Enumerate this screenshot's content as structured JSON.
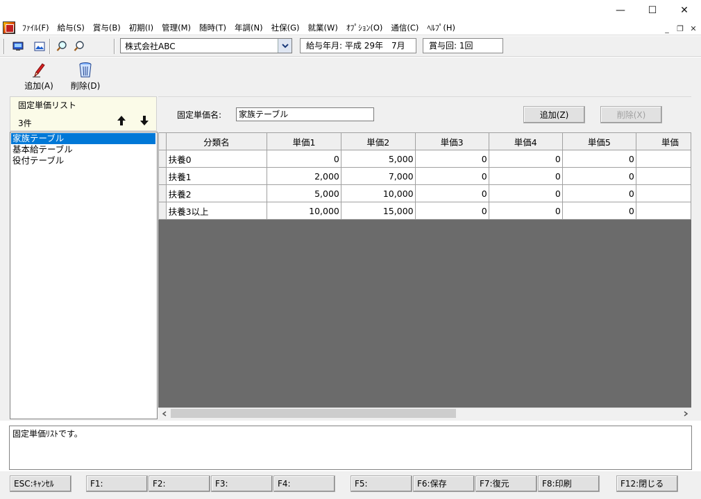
{
  "window": {
    "minimize": "—",
    "maximize": "☐",
    "close": "✕"
  },
  "menu": [
    "ﾌｧｲﾙ(F)",
    "給与(S)",
    "賞与(B)",
    "初期(I)",
    "管理(M)",
    "随時(T)",
    "年調(N)",
    "社保(G)",
    "就業(W)",
    "ｵﾌﾟｼｮﾝ(O)",
    "通信(C)",
    "ﾍﾙﾌﾟ(H)"
  ],
  "mdi": {
    "minimize": "_",
    "restore": "❐",
    "close": "✕"
  },
  "toolbar": {
    "company": "株式会社ABC",
    "pay_period_label": "給与年月:",
    "pay_period_value": "平成 29年　7月",
    "bonus_label": "賞与回:",
    "bonus_value": "1回"
  },
  "actions": {
    "add_label": "追加(A)",
    "delete_label": "削除(D)"
  },
  "list": {
    "title": "固定単価リスト",
    "count": "3件",
    "items": [
      "家族テーブル",
      "基本給テーブル",
      "役付テーブル"
    ],
    "selected_index": 0
  },
  "detail": {
    "name_label": "固定単価名:",
    "name_value": "家族テーブル",
    "add_button": "追加(Z)",
    "delete_button": "削除(X)"
  },
  "grid": {
    "columns": [
      "分類名",
      "単価1",
      "単価2",
      "単価3",
      "単価4",
      "単価5",
      "単価"
    ],
    "rows": [
      [
        "扶養0",
        "0",
        "5,000",
        "0",
        "0",
        "0",
        ""
      ],
      [
        "扶養1",
        "2,000",
        "7,000",
        "0",
        "0",
        "0",
        ""
      ],
      [
        "扶養2",
        "5,000",
        "10,000",
        "0",
        "0",
        "0",
        ""
      ],
      [
        "扶養3以上",
        "10,000",
        "15,000",
        "0",
        "0",
        "0",
        ""
      ]
    ]
  },
  "status_message": "固定単価ﾘｽﾄです。",
  "fkeys": [
    "ESC:ｷｬﾝｾﾙ",
    "F1:",
    "F2:",
    "F3:",
    "F4:",
    "F5:",
    "F6:保存",
    "F7:復元",
    "F8:印刷",
    "F12:閉じる"
  ],
  "colors": {
    "selection": "#0078d7",
    "grid_empty": "#6b6b6b",
    "list_header": "#fbfbe8"
  }
}
